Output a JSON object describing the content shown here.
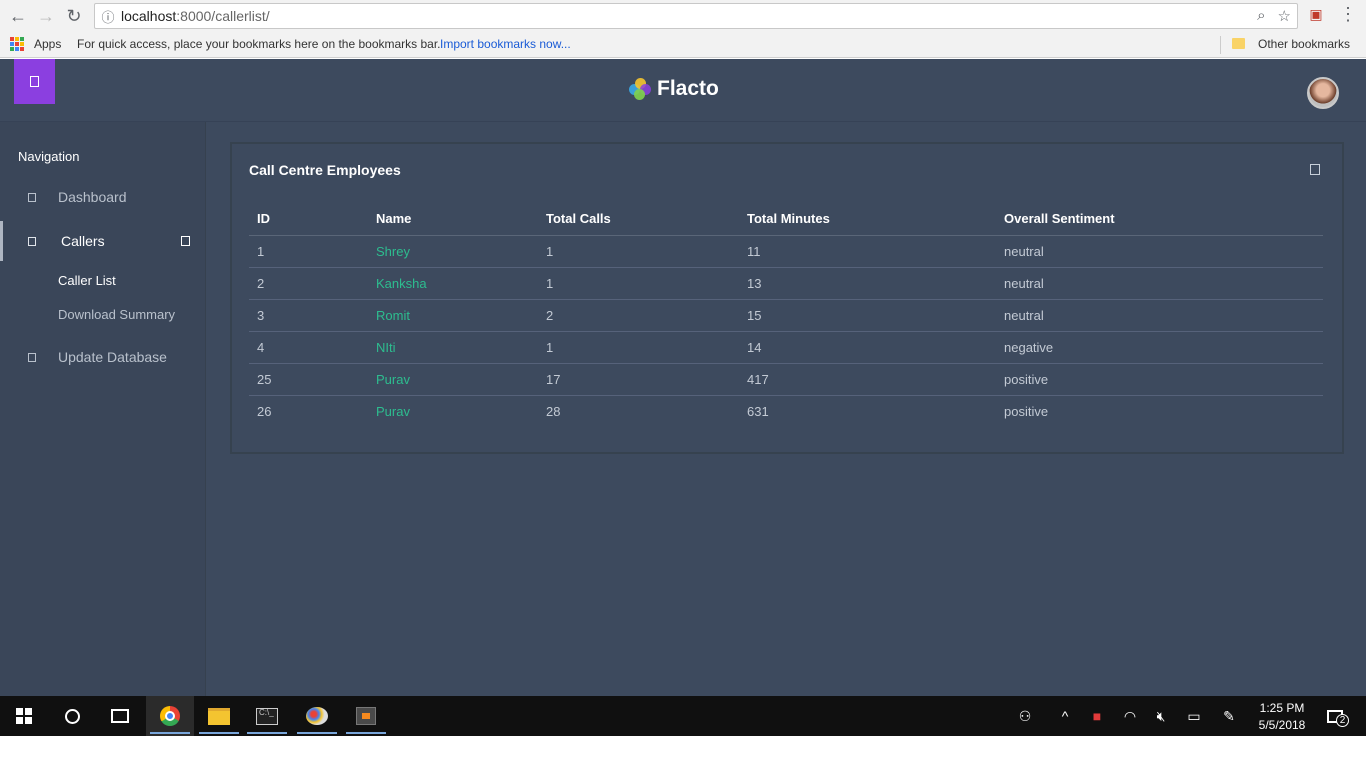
{
  "browser": {
    "url_host": "localhost",
    "url_path": ":8000/callerlist/",
    "bookmarks": {
      "apps_label": "Apps",
      "hint": "For quick access, place your bookmarks here on the bookmarks bar.",
      "import_link": "Import bookmarks now...",
      "other": "Other bookmarks"
    }
  },
  "header": {
    "menu_icon": "menu-icon",
    "brand": "Flacto",
    "logo_colors": [
      "#3aa9e6",
      "#7fd34e",
      "#f4c430",
      "#8b3fe0"
    ],
    "accent": "#8b3fe0"
  },
  "sidebar": {
    "heading": "Navigation",
    "items": [
      {
        "label": "Dashboard",
        "icon": "dashboard-icon"
      },
      {
        "label": "Callers",
        "icon": "callers-icon"
      },
      {
        "label": "Update Database",
        "icon": "database-icon"
      }
    ],
    "sub_items": [
      {
        "label": "Caller List"
      },
      {
        "label": "Download Summary"
      }
    ]
  },
  "panel": {
    "title": "Call Centre Employees",
    "columns": [
      "ID",
      "Name",
      "Total Calls",
      "Total Minutes",
      "Overall Sentiment"
    ],
    "rows": [
      [
        "1",
        "Shrey",
        "1",
        "11",
        "neutral"
      ],
      [
        "2",
        "Kanksha",
        "1",
        "13",
        "neutral"
      ],
      [
        "3",
        "Romit",
        "2",
        "15",
        "neutral"
      ],
      [
        "4",
        "NIti",
        "1",
        "14",
        "negative"
      ],
      [
        "25",
        "Purav",
        "17",
        "417",
        "positive"
      ],
      [
        "26",
        "Purav",
        "28",
        "631",
        "positive"
      ]
    ],
    "name_color": "#2dbd8f"
  },
  "taskbar": {
    "time": "1:25 PM",
    "date": "5/5/2018",
    "notification_count": "2"
  }
}
